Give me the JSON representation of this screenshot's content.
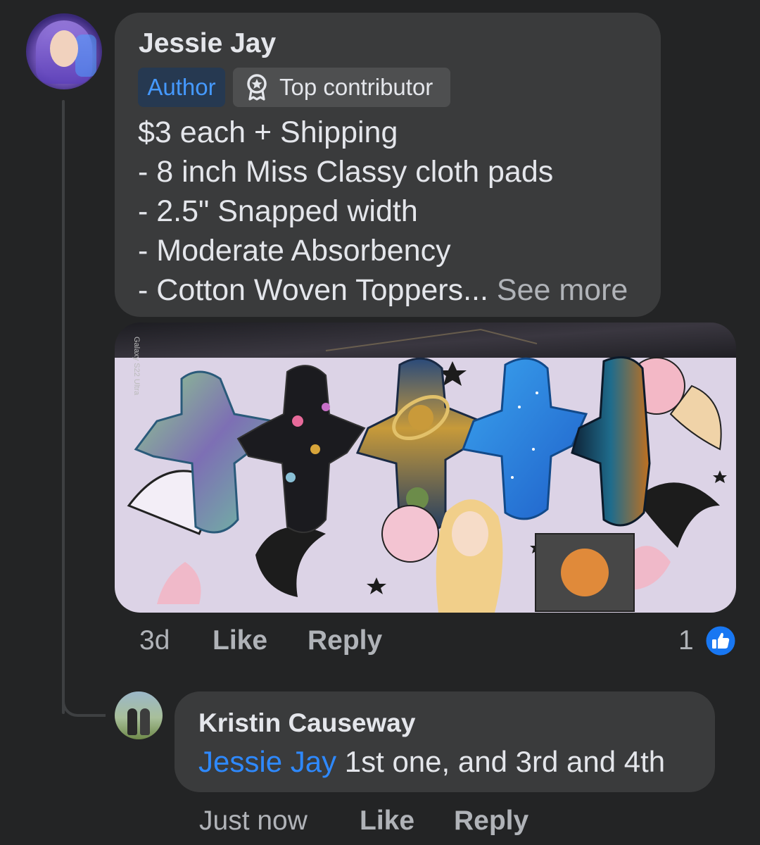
{
  "comment": {
    "author": "Jessie Jay",
    "badges": {
      "author": "Author",
      "contributor": "Top contributor"
    },
    "lines": [
      "$3 each + Shipping",
      "- 8 inch Miss Classy cloth pads",
      "- 2.5\" Snapped width",
      "- Moderate Absorbency"
    ],
    "last_line": "- Cotton Woven Toppers...",
    "see_more": "See more",
    "image_watermark": "Galaxy S22 Ultra",
    "time": "3d",
    "like_label": "Like",
    "reply_label": "Reply",
    "reaction_count": "1"
  },
  "reply": {
    "author": "Kristin Causeway",
    "mention": "Jessie Jay",
    "text": "1st one, and 3rd and 4th",
    "time": "Just now",
    "like_label": "Like",
    "reply_label": "Reply"
  },
  "colors": {
    "background": "#232425",
    "bubble": "#3a3b3c",
    "link_blue": "#2e89ff",
    "author_badge_bg": "#263951",
    "reaction_blue": "#1877f2"
  },
  "icons": [
    "award-icon",
    "like-reaction-icon"
  ]
}
